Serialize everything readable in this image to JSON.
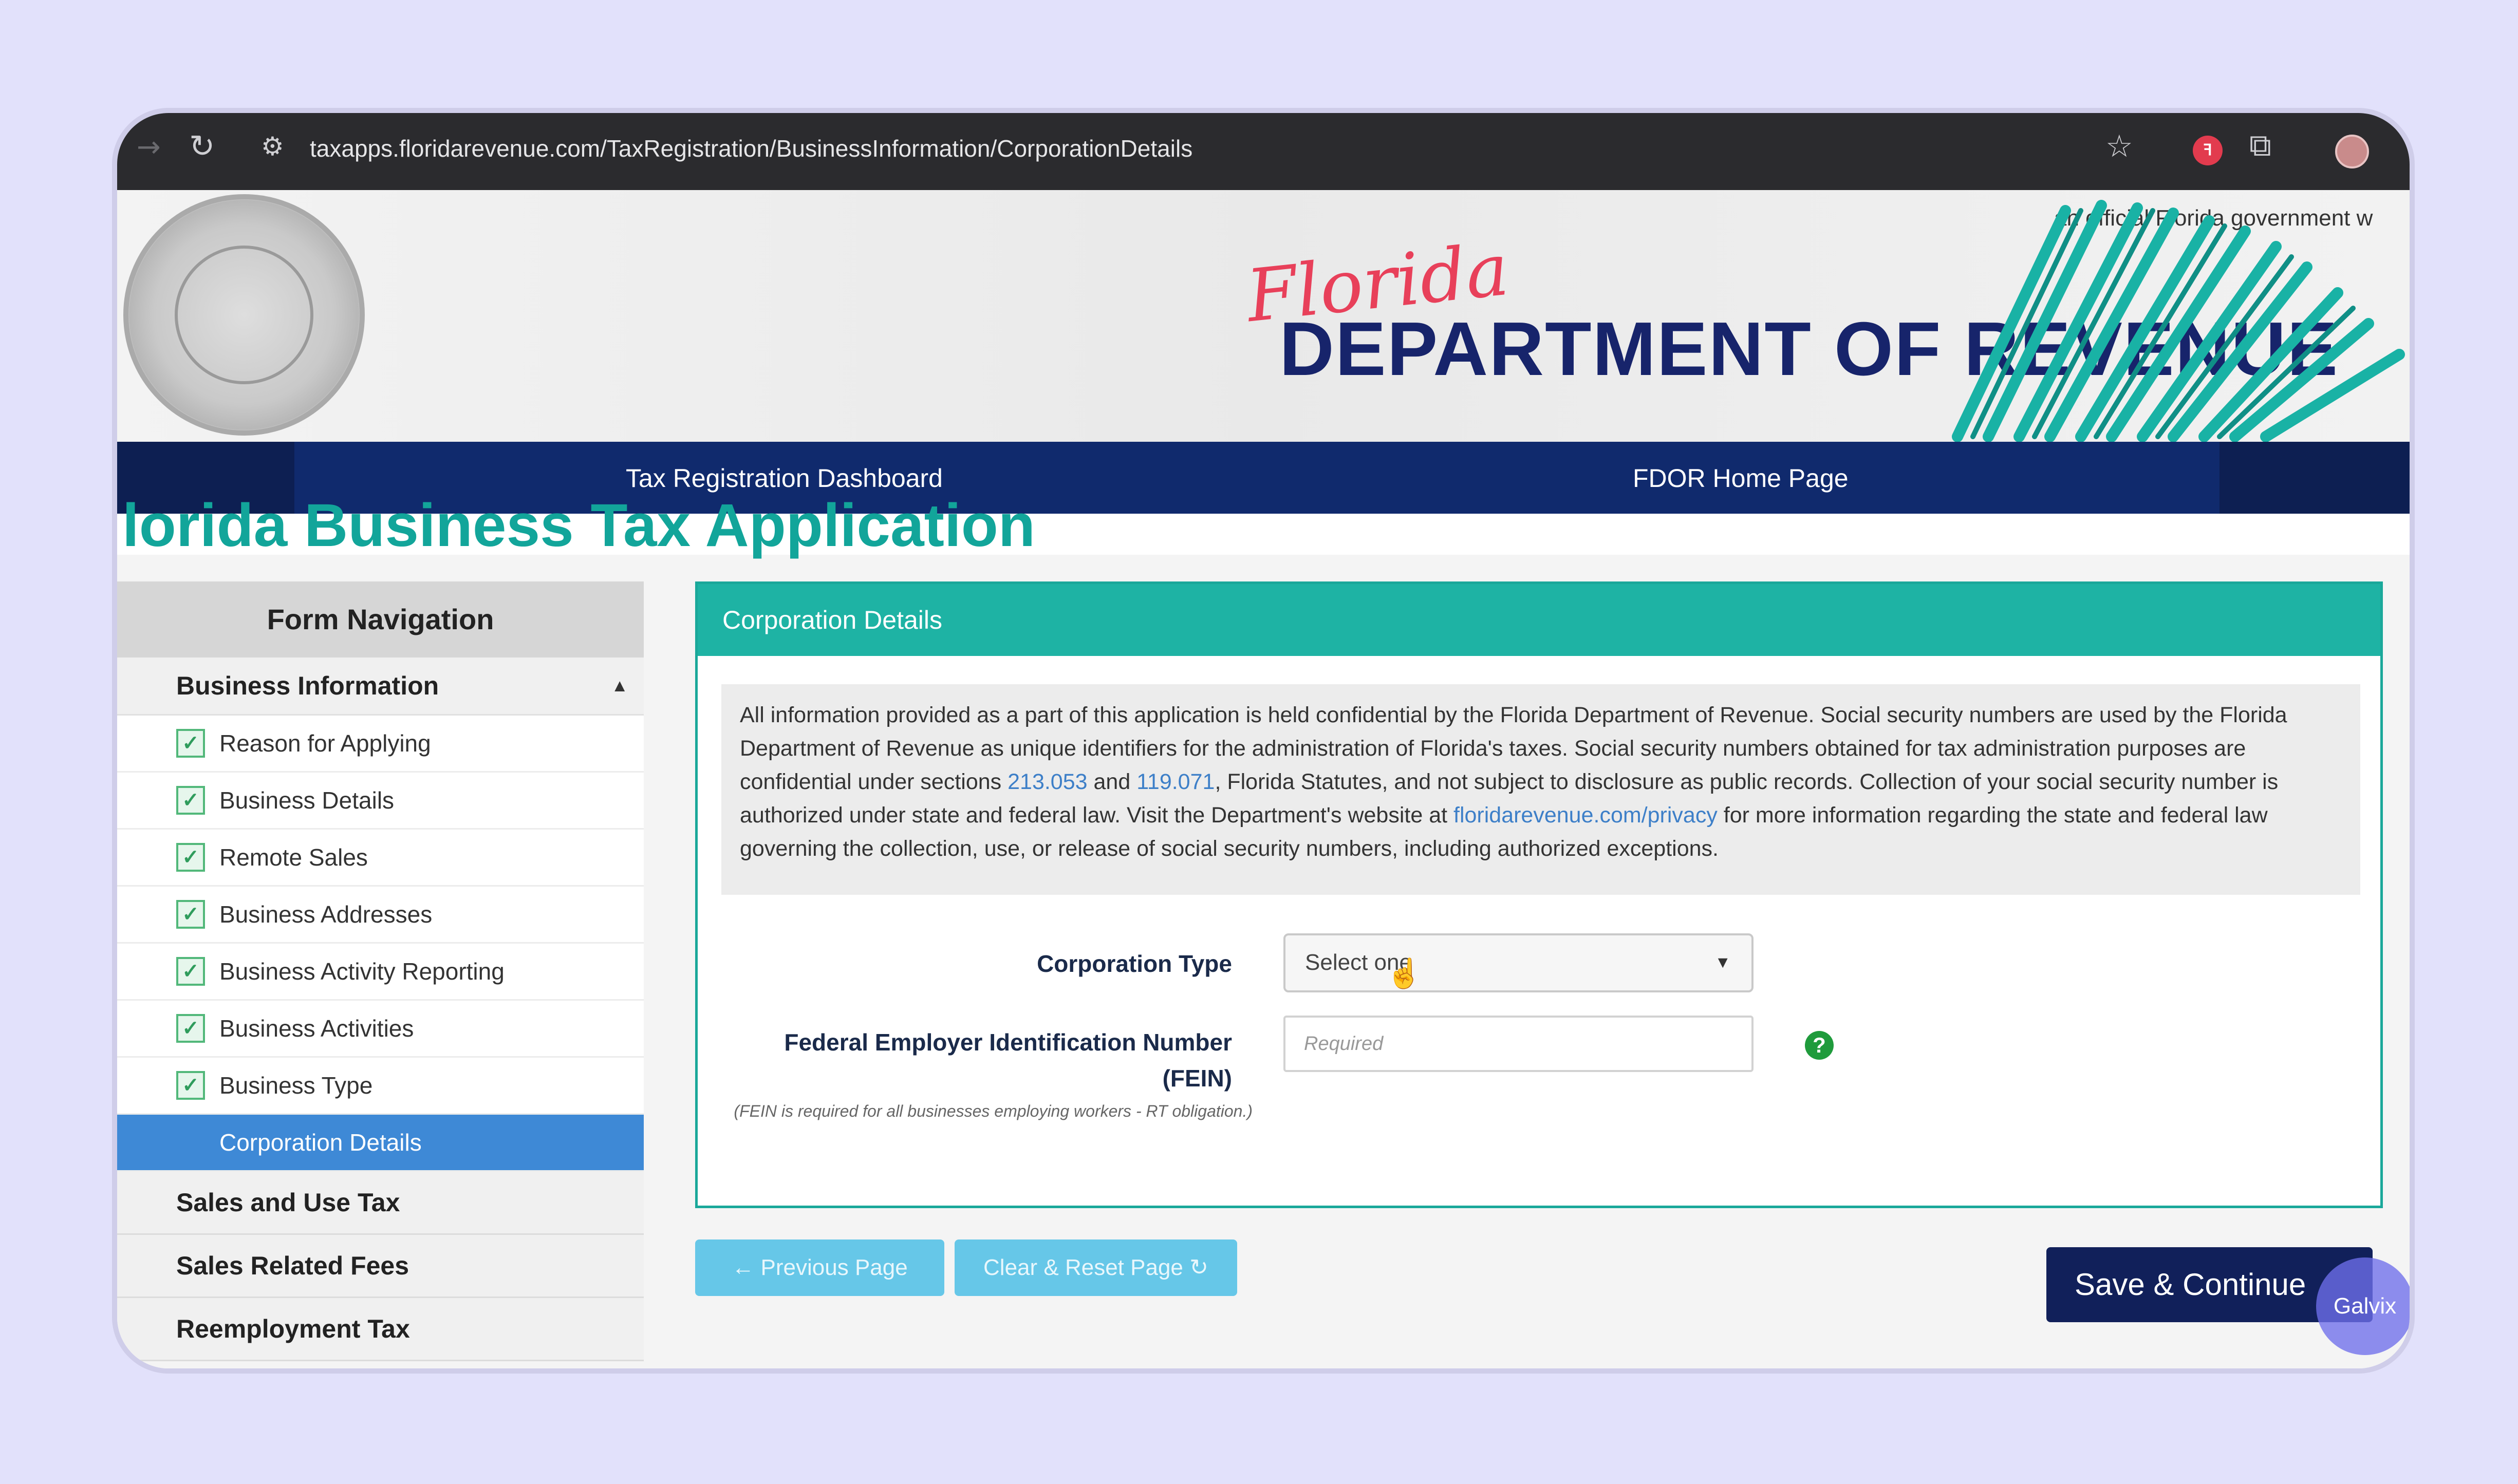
{
  "browser": {
    "url": "taxapps.floridarevenue.com/TaxRegistration/BusinessInformation/CorporationDetails"
  },
  "header": {
    "official_notice": "an official Florida government w",
    "script_word": "Florida",
    "department_name": "DEPARTMENT OF REVENUE"
  },
  "nav": {
    "links": [
      "Tax Registration Dashboard",
      "FDOR Home Page"
    ]
  },
  "page_title": "lorida Business Tax Application",
  "form_nav": {
    "title": "Form Navigation",
    "section": "Business Information",
    "items": [
      "Reason for Applying",
      "Business Details",
      "Remote Sales",
      "Business Addresses",
      "Business Activity Reporting",
      "Business Activities",
      "Business Type"
    ],
    "active_item": "Corporation Details",
    "other_sections": [
      "Sales and Use Tax",
      "Sales Related Fees",
      "Reemployment Tax"
    ]
  },
  "panel": {
    "title": "Corporation Details",
    "notice": {
      "part1": "All information provided as a part of this application is held confidential by the Florida Department of Revenue. Social security numbers are used by the Florida Department of Revenue as unique identifiers for the administration of Florida's taxes. Social security numbers obtained for tax administration purposes are confidential under sections ",
      "link1": "213.053",
      "part2": " and ",
      "link2": "119.071",
      "part3": ", Florida Statutes, and not subject to disclosure as public records. Collection of your social security number is authorized under state and federal law. Visit the Department's website at ",
      "link3": "floridarevenue.com/privacy",
      "part4": " for more information regarding the state and federal law governing the collection, use, or release of social security numbers, including authorized exceptions."
    },
    "corporation_type_label": "Corporation Type",
    "corporation_type_value": "Select one",
    "fein_label_line1": "Federal Employer Identification Number",
    "fein_label_line2": "(FEIN)",
    "fein_placeholder": "Required",
    "fein_note": "(FEIN is required for all businesses employing workers - RT obligation.)"
  },
  "buttons": {
    "previous": "Previous Page",
    "clear": "Clear & Reset Page",
    "save": "Save & Continue"
  },
  "overlay_badge": "Galvix"
}
